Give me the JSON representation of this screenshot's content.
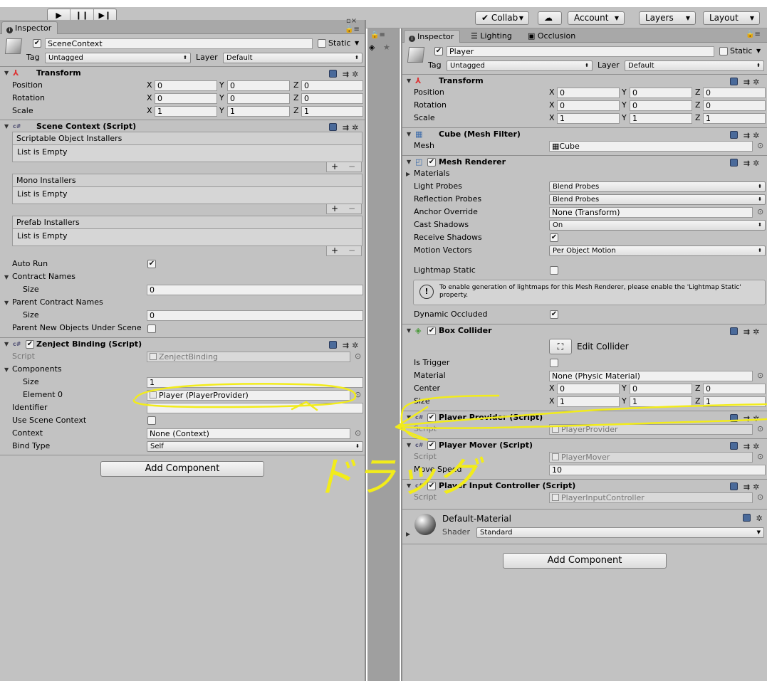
{
  "toolbar": {
    "collab": "Collab",
    "account": "Account",
    "layers": "Layers",
    "layout": "Layout",
    "play": "▶",
    "pause": "❙❙",
    "step": "▶❙"
  },
  "left": {
    "tab": "Inspector",
    "object_name": "SceneContext",
    "static_label": "Static",
    "tag_label": "Tag",
    "tag_value": "Untagged",
    "layer_label": "Layer",
    "layer_value": "Default",
    "transform": {
      "title": "Transform",
      "position": "Position",
      "rotation": "Rotation",
      "scale": "Scale",
      "pos": [
        "0",
        "0",
        "0"
      ],
      "rot": [
        "0",
        "0",
        "0"
      ],
      "scl": [
        "1",
        "1",
        "1"
      ]
    },
    "scene_context": {
      "title": "Scene Context (Script)",
      "lists": [
        {
          "header": "Scriptable Object Installers",
          "body": "List is Empty"
        },
        {
          "header": "Mono Installers",
          "body": "List is Empty"
        },
        {
          "header": "Prefab Installers",
          "body": "List is Empty"
        }
      ],
      "auto_run": "Auto Run",
      "contract_names": "Contract Names",
      "size": "Size",
      "contract_size": "0",
      "parent_contract_names": "Parent Contract Names",
      "parent_size": "0",
      "parent_new_objects": "Parent New Objects Under Scene"
    },
    "zenject_binding": {
      "title": "Zenject Binding (Script)",
      "script_label": "Script",
      "script_value": "ZenjectBinding",
      "components": "Components",
      "size": "Size",
      "size_value": "1",
      "element0": "Element 0",
      "element0_value": "Player (PlayerProvider)",
      "identifier": "Identifier",
      "use_scene_context": "Use Scene Context",
      "context": "Context",
      "context_value": "None (Context)",
      "bind_type": "Bind Type",
      "bind_type_value": "Self"
    },
    "add_component": "Add Component"
  },
  "right": {
    "tabs": [
      "Inspector",
      "Lighting",
      "Occlusion"
    ],
    "object_name": "Player",
    "static_label": "Static",
    "tag_label": "Tag",
    "tag_value": "Untagged",
    "layer_label": "Layer",
    "layer_value": "Default",
    "transform": {
      "title": "Transform",
      "position": "Position",
      "rotation": "Rotation",
      "scale": "Scale",
      "pos": [
        "0",
        "0",
        "0"
      ],
      "rot": [
        "0",
        "0",
        "0"
      ],
      "scl": [
        "1",
        "1",
        "1"
      ]
    },
    "mesh_filter": {
      "title": "Cube (Mesh Filter)",
      "mesh_label": "Mesh",
      "mesh_value": "Cube"
    },
    "mesh_renderer": {
      "title": "Mesh Renderer",
      "materials": "Materials",
      "light_probes": "Light Probes",
      "light_probes_value": "Blend Probes",
      "reflection_probes": "Reflection Probes",
      "reflection_probes_value": "Blend Probes",
      "anchor_override": "Anchor Override",
      "anchor_override_value": "None (Transform)",
      "cast_shadows": "Cast Shadows",
      "cast_shadows_value": "On",
      "receive_shadows": "Receive Shadows",
      "motion_vectors": "Motion Vectors",
      "motion_vectors_value": "Per Object Motion",
      "lightmap_static": "Lightmap Static",
      "help": "To enable generation of lightmaps for this Mesh Renderer, please enable the 'Lightmap Static' property.",
      "dynamic_occluded": "Dynamic Occluded"
    },
    "box_collider": {
      "title": "Box Collider",
      "edit_collider": "Edit Collider",
      "is_trigger": "Is Trigger",
      "material": "Material",
      "material_value": "None (Physic Material)",
      "center": "Center",
      "size": "Size",
      "center_vals": [
        "0",
        "0",
        "0"
      ],
      "size_vals": [
        "1",
        "1",
        "1"
      ]
    },
    "player_provider": {
      "title": "Player Provider (Script)",
      "script_label": "Script",
      "script_value": "PlayerProvider"
    },
    "player_mover": {
      "title": "Player Mover (Script)",
      "script_label": "Script",
      "script_value": "PlayerMover",
      "move_speed": "Move Speed",
      "move_speed_value": "10"
    },
    "player_input": {
      "title": "Player Input Controller (Script)",
      "script_label": "Script",
      "script_value": "PlayerInputController"
    },
    "material": {
      "name": "Default-Material",
      "shader_label": "Shader",
      "shader_value": "Standard"
    },
    "add_component": "Add Component"
  },
  "annotation": {
    "text": "ドラッグ",
    "color": "#f2ec1a"
  }
}
